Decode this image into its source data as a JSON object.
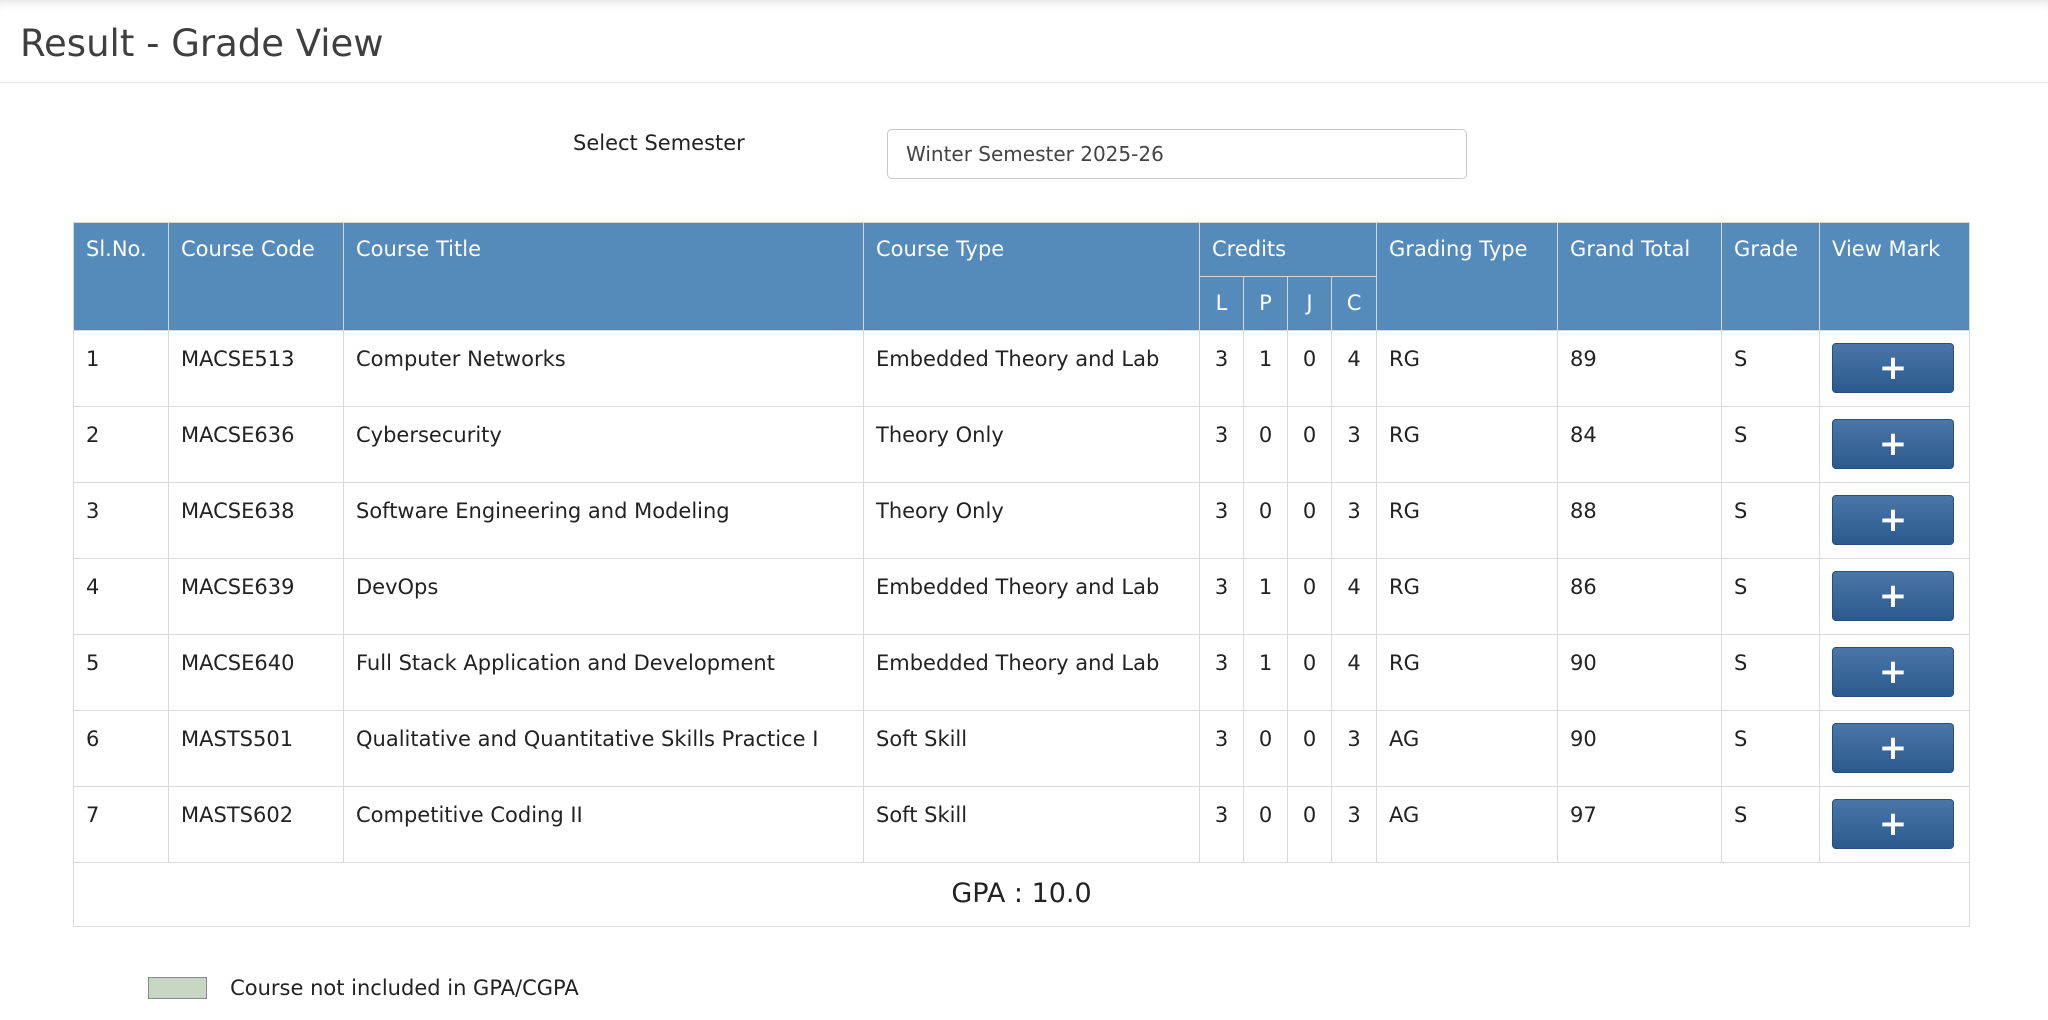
{
  "header": {
    "title": "Result - Grade View"
  },
  "semester": {
    "label": "Select Semester",
    "selected": "Winter Semester 2025-26"
  },
  "table": {
    "headers": {
      "sl_no": "Sl.No.",
      "course_code": "Course Code",
      "course_title": "Course Title",
      "course_type": "Course Type",
      "credits": "Credits",
      "credit_l": "L",
      "credit_p": "P",
      "credit_j": "J",
      "credit_c": "C",
      "grading_type": "Grading Type",
      "grand_total": "Grand Total",
      "grade": "Grade",
      "view_mark": "View Mark"
    },
    "rows": [
      {
        "sl": "1",
        "code": "MACSE513",
        "title": "Computer Networks",
        "type": "Embedded Theory and Lab",
        "l": "3",
        "p": "1",
        "j": "0",
        "c": "4",
        "grading": "RG",
        "total": "89",
        "grade": "S",
        "view": "+"
      },
      {
        "sl": "2",
        "code": "MACSE636",
        "title": "Cybersecurity",
        "type": "Theory Only",
        "l": "3",
        "p": "0",
        "j": "0",
        "c": "3",
        "grading": "RG",
        "total": "84",
        "grade": "S",
        "view": "+"
      },
      {
        "sl": "3",
        "code": "MACSE638",
        "title": "Software Engineering and Modeling",
        "type": "Theory Only",
        "l": "3",
        "p": "0",
        "j": "0",
        "c": "3",
        "grading": "RG",
        "total": "88",
        "grade": "S",
        "view": "+"
      },
      {
        "sl": "4",
        "code": "MACSE639",
        "title": "DevOps",
        "type": "Embedded Theory and Lab",
        "l": "3",
        "p": "1",
        "j": "0",
        "c": "4",
        "grading": "RG",
        "total": "86",
        "grade": "S",
        "view": "+"
      },
      {
        "sl": "5",
        "code": "MACSE640",
        "title": "Full Stack Application and Development",
        "type": "Embedded Theory and Lab",
        "l": "3",
        "p": "1",
        "j": "0",
        "c": "4",
        "grading": "RG",
        "total": "90",
        "grade": "S",
        "view": "+"
      },
      {
        "sl": "6",
        "code": "MASTS501",
        "title": "Qualitative and Quantitative Skills Practice I",
        "type": "Soft Skill",
        "l": "3",
        "p": "0",
        "j": "0",
        "c": "3",
        "grading": "AG",
        "total": "90",
        "grade": "S",
        "view": "+"
      },
      {
        "sl": "7",
        "code": "MASTS602",
        "title": "Competitive Coding II",
        "type": "Soft Skill",
        "l": "3",
        "p": "0",
        "j": "0",
        "c": "3",
        "grading": "AG",
        "total": "97",
        "grade": "S",
        "view": "+"
      }
    ],
    "gpa": "GPA : 10.0"
  },
  "legend": {
    "text": "Course not included in GPA/CGPA",
    "swatch_color": "#c7d7c3"
  },
  "colors": {
    "header_bg": "#548bba",
    "button_bg": "#2c5a8e"
  }
}
